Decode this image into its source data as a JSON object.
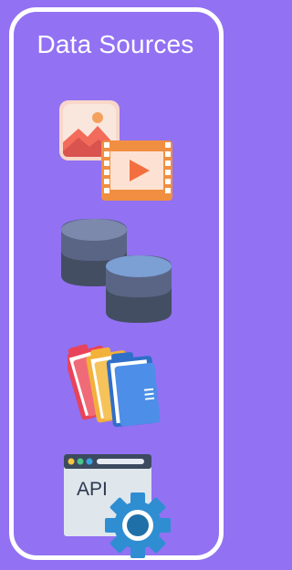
{
  "panel": {
    "title": "Data Sources"
  },
  "icons": {
    "media": "image-and-video-icon",
    "database": "database-icon",
    "folders": "folders-icon",
    "api": "api-settings-icon"
  },
  "api_icon": {
    "label": "API"
  },
  "colors": {
    "background": "#9271f3",
    "panel_border": "#ffffff",
    "title_text": "#ffffff"
  }
}
